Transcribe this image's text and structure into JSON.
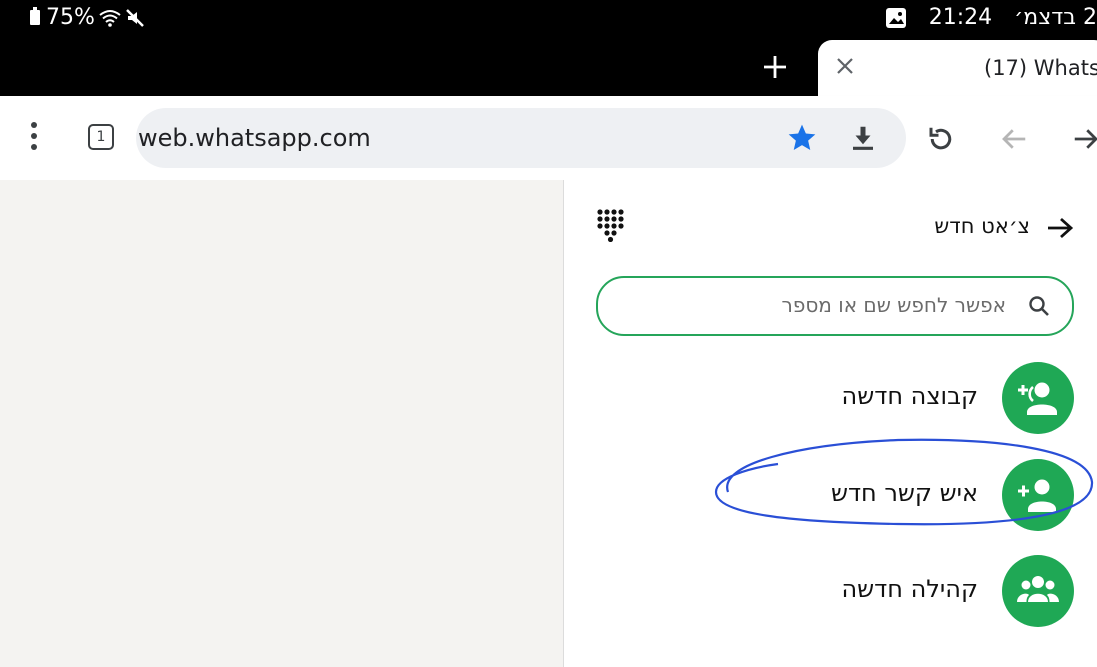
{
  "status_bar": {
    "battery": "75%",
    "time": "21:24",
    "date": "2 בדצמ׳"
  },
  "tab": {
    "title": "(17) Whats",
    "new_tab_icon": "plus-icon",
    "close_icon": "close-icon"
  },
  "toolbar": {
    "url": "web.whatsapp.com",
    "tab_count": "1",
    "accent": "#1a73e8"
  },
  "panel": {
    "title": "צ׳אט חדש",
    "search": {
      "placeholder": "אפשר לחפש שם או מספר",
      "value": ""
    },
    "items": [
      {
        "label": "קבוצה חדשה",
        "icon": "add-group-icon"
      },
      {
        "label": "איש קשר חדש",
        "icon": "add-contact-icon"
      },
      {
        "label": "קהילה חדשה",
        "icon": "community-icon"
      }
    ],
    "brand_color": "#1fa855"
  }
}
